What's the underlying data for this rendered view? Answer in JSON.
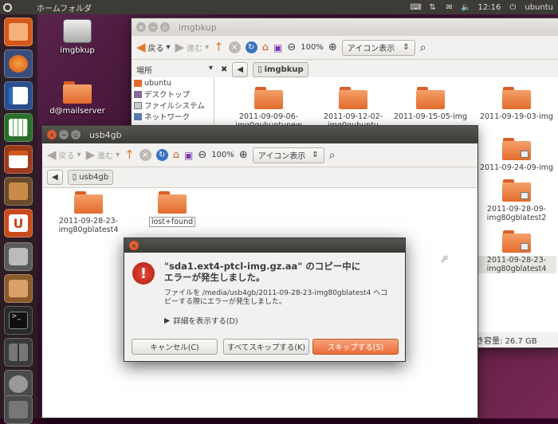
{
  "top_panel": {
    "title": "ホームフォルダ",
    "time": "12:16",
    "user": "ubuntu"
  },
  "desktop_icons": [
    {
      "label": "imgbkup"
    },
    {
      "label": "d@mailserver"
    }
  ],
  "imgbkup_window": {
    "title": "imgbkup",
    "back": "戻る",
    "forward": "進む",
    "zoom": "100%",
    "view": "アイコン表示",
    "places_label": "場所",
    "path_button": "imgbkup",
    "sidebar": [
      "ubuntu",
      "デスクトップ",
      "ファイルシステム",
      "ネットワーク"
    ],
    "folders": [
      [
        "2011-09-09-06-",
        "img0gubuntunew"
      ],
      [
        "2011-09-12-02-",
        "img0gubuntu"
      ],
      [
        "2011-09-15-05-img"
      ],
      [
        "2011-09-19-03-img"
      ],
      [
        "2011-09-24-09-img"
      ],
      [
        "2011-09-28-09-",
        "img80gblatest2"
      ],
      [
        "2011-09-28-23-",
        "img80gblatest4"
      ]
    ],
    "free_space": "き容量: 26.7 GB"
  },
  "usb_window": {
    "title": "usb4gb",
    "back": "戻る",
    "forward": "進む",
    "zoom": "100%",
    "view": "アイコン表示",
    "path_button": "usb4gb",
    "folders": [
      [
        "2011-09-28-23-",
        "img80gblatest4"
      ],
      [
        "lost+found"
      ]
    ]
  },
  "dialog": {
    "heading_line1": "\"sda1.ext4-ptcl-img.gz.aa\" のコピー中に",
    "heading_line2": "エラーが発生しました。",
    "message_line1": "ファイルを /media/usb4gb/2011-09-28-23-img80gblatest4 へコ",
    "message_line2": "ピーする際にエラーが発生しました。",
    "details": "詳細を表示する(D)",
    "cancel": "キャンセル(C)",
    "skip_all": "すべてスキップする(K)",
    "skip": "スキップする(S)"
  }
}
